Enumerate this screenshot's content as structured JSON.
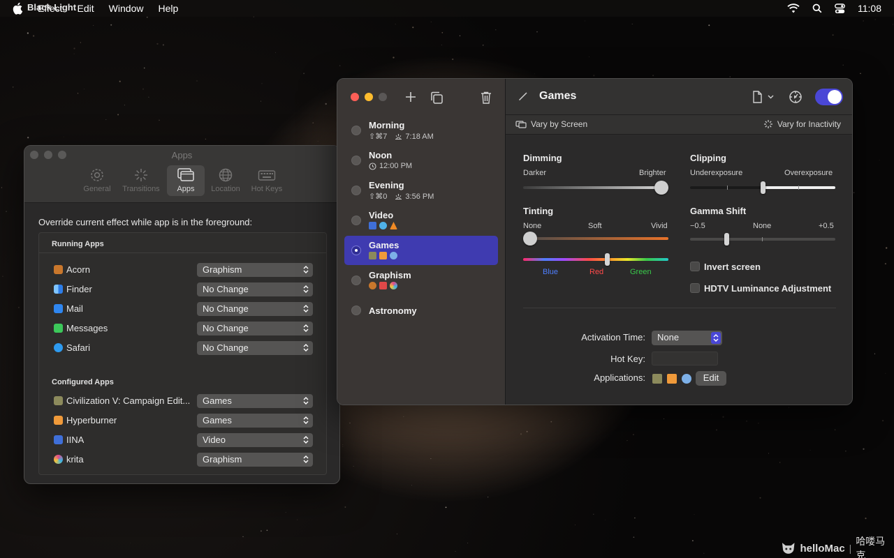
{
  "menubar": {
    "app_name": "Black Light",
    "items": [
      "Effect",
      "Edit",
      "Window",
      "Help"
    ],
    "clock": "11:08"
  },
  "apps_window": {
    "title": "Apps",
    "tabs": [
      {
        "label": "General",
        "icon": "gear-icon"
      },
      {
        "label": "Transitions",
        "icon": "sparkle-burst-icon"
      },
      {
        "label": "Apps",
        "icon": "windows-icon"
      },
      {
        "label": "Location",
        "icon": "globe-icon"
      },
      {
        "label": "Hot Keys",
        "icon": "keyboard-icon"
      }
    ],
    "active_tab": "Apps",
    "override_text": "Override current effect while app is in the foreground:",
    "running_header": "Running Apps",
    "running_apps": [
      {
        "name": "Acorn",
        "effect": "Graphism",
        "color": "#c9772c"
      },
      {
        "name": "Finder",
        "effect": "No Change",
        "color": "#3b8fe8"
      },
      {
        "name": "Mail",
        "effect": "No Change",
        "color": "#2f86f0"
      },
      {
        "name": "Messages",
        "effect": "No Change",
        "color": "#3cc85a"
      },
      {
        "name": "Safari",
        "effect": "No Change",
        "color": "#2e9bf0"
      }
    ],
    "configured_header": "Configured Apps",
    "configured_apps": [
      {
        "name": "Civilization V: Campaign Edit...",
        "effect": "Games",
        "color": "#8c8a5c"
      },
      {
        "name": "Hyperburner",
        "effect": "Games",
        "color": "#f09a3a"
      },
      {
        "name": "IINA",
        "effect": "Video",
        "color": "#3f6fd8"
      },
      {
        "name": "krita",
        "effect": "Graphism",
        "color": "#d05aa8"
      }
    ]
  },
  "games_window": {
    "effects": [
      {
        "name": "Morning",
        "shortcut": "⇧⌘7",
        "time": "7:18 AM",
        "kind": "sunrise"
      },
      {
        "name": "Noon",
        "shortcut": "",
        "time": "12:00 PM",
        "kind": "clock"
      },
      {
        "name": "Evening",
        "shortcut": "⇧⌘0",
        "time": "3:56 PM",
        "kind": "sunset"
      },
      {
        "name": "Video",
        "kind": "apps"
      },
      {
        "name": "Games",
        "kind": "apps",
        "selected": true
      },
      {
        "name": "Graphism",
        "kind": "apps"
      },
      {
        "name": "Astronomy",
        "kind": "none"
      }
    ],
    "title": "Games",
    "enabled": true,
    "vary_screen": "Vary by Screen",
    "vary_inactivity": "Vary for Inactivity",
    "dimming": {
      "title": "Dimming",
      "left": "Darker",
      "right": "Brighter",
      "value": 1.0
    },
    "clipping": {
      "title": "Clipping",
      "left": "Underexposure",
      "right": "Overexposure",
      "value": 0.5
    },
    "tinting": {
      "title": "Tinting",
      "none": "None",
      "soft": "Soft",
      "vivid": "Vivid",
      "value": 0.0,
      "hue_blue": "Blue",
      "hue_red": "Red",
      "hue_green": "Green",
      "hue_value": 0.58,
      "hue_colors": {
        "blue": "#4f7fff",
        "red": "#ff4a4a",
        "green": "#39c94a"
      }
    },
    "gamma": {
      "title": "Gamma Shift",
      "left": "−0.5",
      "center": "None",
      "right": "+0.5",
      "value": -0.25
    },
    "invert_label": "Invert screen",
    "invert_checked": false,
    "hdtv_label": "HDTV Luminance Adjustment",
    "hdtv_checked": false,
    "activation_label": "Activation Time:",
    "activation_value": "None",
    "hotkey_label": "Hot Key:",
    "applications_label": "Applications:",
    "edit_label": "Edit"
  },
  "watermark": {
    "brand": "helloMac",
    "cn": "哈喽马克"
  }
}
